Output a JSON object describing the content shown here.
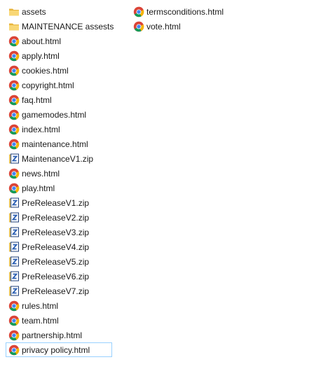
{
  "files": {
    "column1": [
      {
        "name": "assets",
        "icon": "folder-icon"
      },
      {
        "name": "MAINTENANCE assests",
        "icon": "folder-icon"
      },
      {
        "name": "about.html",
        "icon": "chrome-icon"
      },
      {
        "name": "apply.html",
        "icon": "chrome-icon"
      },
      {
        "name": "cookies.html",
        "icon": "chrome-icon"
      },
      {
        "name": "copyright.html",
        "icon": "chrome-icon"
      },
      {
        "name": "faq.html",
        "icon": "chrome-icon"
      },
      {
        "name": "gamemodes.html",
        "icon": "chrome-icon"
      },
      {
        "name": "index.html",
        "icon": "chrome-icon"
      },
      {
        "name": "maintenance.html",
        "icon": "chrome-icon"
      },
      {
        "name": "MaintenanceV1.zip",
        "icon": "zip-icon"
      },
      {
        "name": "news.html",
        "icon": "chrome-icon"
      },
      {
        "name": "play.html",
        "icon": "chrome-icon"
      },
      {
        "name": "PreReleaseV1.zip",
        "icon": "zip-icon"
      },
      {
        "name": "PreReleaseV2.zip",
        "icon": "zip-icon"
      },
      {
        "name": "PreReleaseV3.zip",
        "icon": "zip-icon"
      },
      {
        "name": "PreReleaseV4.zip",
        "icon": "zip-icon"
      },
      {
        "name": "PreReleaseV5.zip",
        "icon": "zip-icon"
      },
      {
        "name": "PreReleaseV6.zip",
        "icon": "zip-icon"
      },
      {
        "name": "PreReleaseV7.zip",
        "icon": "zip-icon"
      },
      {
        "name": "rules.html",
        "icon": "chrome-icon"
      },
      {
        "name": "team.html",
        "icon": "chrome-icon"
      },
      {
        "name": "partnership.html",
        "icon": "chrome-icon"
      },
      {
        "name": "privacy policy.html",
        "icon": "chrome-icon",
        "selected": true
      }
    ],
    "column2": [
      {
        "name": "termsconditions.html",
        "icon": "chrome-icon"
      },
      {
        "name": "vote.html",
        "icon": "chrome-icon"
      }
    ]
  },
  "colors": {
    "selection_border": "#99d1ff",
    "folder": "#f5c94d",
    "zip_blue": "#2b5fb3"
  }
}
